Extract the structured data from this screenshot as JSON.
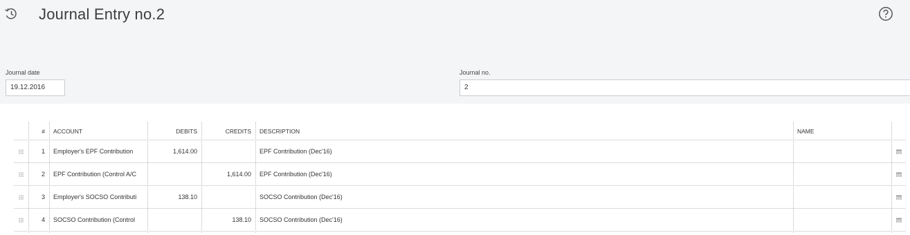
{
  "header": {
    "title": "Journal Entry no.2",
    "history_icon": "history-icon",
    "help_icon": "help-icon"
  },
  "form": {
    "journal_date": {
      "label": "Journal date",
      "value": "19.12.2016"
    },
    "journal_no": {
      "label": "Journal no.",
      "value": "2"
    }
  },
  "table": {
    "columns": {
      "num": "#",
      "account": "ACCOUNT",
      "debits": "DEBITS",
      "credits": "CREDITS",
      "description": "DESCRIPTION",
      "name": "NAME"
    },
    "rows": [
      {
        "num": "1",
        "account": "Employer's EPF Contribution",
        "debits": "1,614.00",
        "credits": "",
        "description": "EPF Contribution (Dec'16)",
        "name": ""
      },
      {
        "num": "2",
        "account": "EPF Contribution (Control A/C",
        "debits": "",
        "credits": "1,614.00",
        "description": "EPF Contribution (Dec'16)",
        "name": ""
      },
      {
        "num": "3",
        "account": "Employer's SOCSO Contributi",
        "debits": "138.10",
        "credits": "",
        "description": "SOCSO Contribution (Dec'16)",
        "name": ""
      },
      {
        "num": "4",
        "account": "SOCSO Contribution (Control",
        "debits": "",
        "credits": "138.10",
        "description": "SOCSO Contribution (Dec'16)",
        "name": ""
      }
    ]
  },
  "colors": {
    "header_background": "#f4f5f6",
    "border": "#dcdcdc",
    "text": "#333333"
  }
}
